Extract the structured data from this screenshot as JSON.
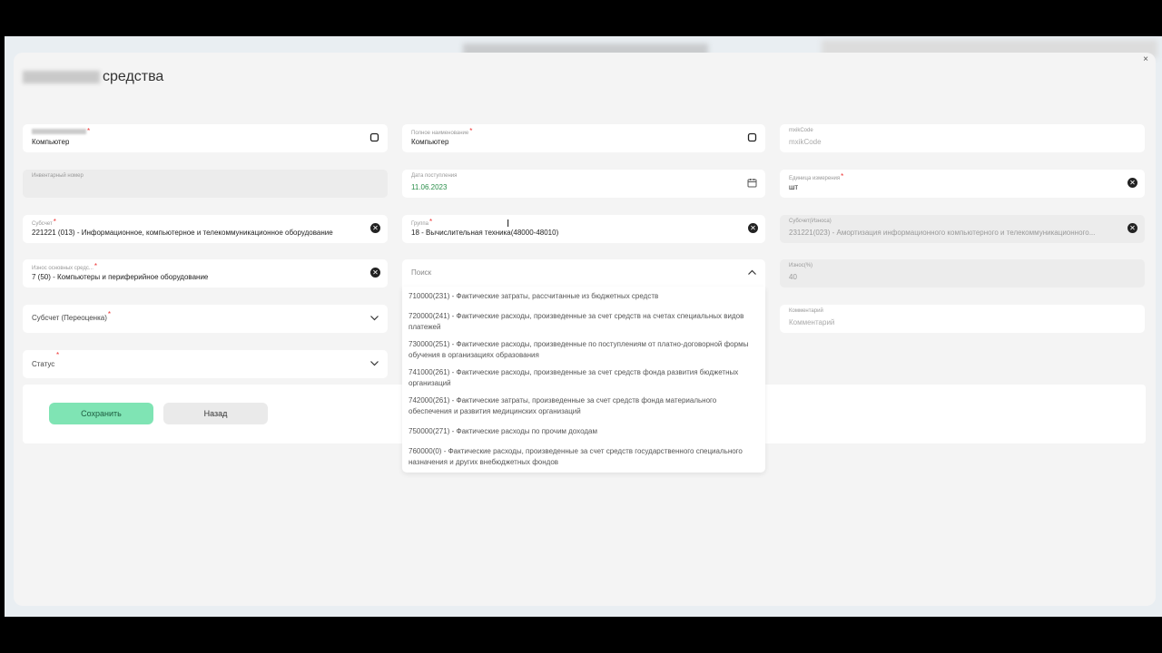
{
  "page": {
    "title_suffix": "средства"
  },
  "fields": {
    "name": {
      "value": "Компьютер"
    },
    "full_name": {
      "label": "Полное наименование",
      "value": "Компьютер"
    },
    "mxik": {
      "label": "mxikCode",
      "placeholder": "mxikCode"
    },
    "inventory": {
      "label": "Инвентарный номер"
    },
    "receipt_date": {
      "label": "Дата поступления",
      "value": "11.06.2023"
    },
    "unit": {
      "label": "Единица измерения",
      "value": "шт"
    },
    "subaccount": {
      "label": "Субсчет",
      "value": "221221 (013) - Информационное, компьютерное и телекоммуникационное оборудование"
    },
    "group": {
      "label": "Группа",
      "value": "18 - Вычислительная техника(48000-48010)"
    },
    "subaccount_wear": {
      "label": "Субсчет(Износа)",
      "value": "231221(023) - Амортизация информационного компьютерного и телекоммуникационного..."
    },
    "wear_fixed": {
      "label": "Износ основных средс...",
      "value": "7 (50) - Компьютеры и периферийное оборудование"
    },
    "search": {
      "placeholder": "Поиск"
    },
    "wear_percent": {
      "label": "Износ(%)",
      "value": "40"
    },
    "subaccount_reval": {
      "label": "Субсчет (Переоценка)"
    },
    "comment": {
      "label": "Комментарий",
      "placeholder": "Комментарий"
    },
    "status": {
      "label": "Статус"
    }
  },
  "dropdown": {
    "options": [
      "710000(231) - Фактические затраты, рассчитанные из бюджетных средств",
      "720000(241) - Фактические расходы, произведенные за счет средств на счетах специальных видов платежей",
      "730000(251) - Фактические расходы, произведенные по поступлениям от платно-договорной формы обучения в организациях образования",
      "741000(261) - Фактические расходы, произведенные за счет средств фонда развития бюджетных организаций",
      "742000(261) - Фактические затраты, произведенные за счет средств фонда материального обеспечения и развития медицинских организаций",
      "750000(271) - Фактические расходы по прочим доходам",
      "760000(0) - Фактические расходы, произведенные за счет средств государственного специального назначения и других внебюджетных фондов"
    ]
  },
  "buttons": {
    "save": "Сохранить",
    "back": "Назад"
  },
  "colors": {
    "save_button": "#7fe4b4",
    "date_value": "#2a8f4a",
    "required": "#e33333"
  }
}
